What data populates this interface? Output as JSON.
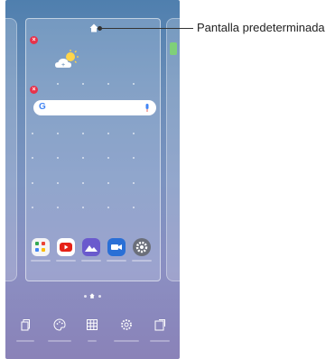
{
  "callout": {
    "label": "Pantalla predeterminada"
  },
  "colors": {
    "remove_badge": "#e8324a",
    "youtube": "#e62117",
    "gallery": "#6a5acd",
    "camera": "#2a6fd6",
    "settings": "#6b6f7a"
  },
  "home_screen": {
    "search_widget": {
      "logo": "G"
    },
    "apps": [
      {
        "name": "folder-app-icon"
      },
      {
        "name": "youtube-app-icon"
      },
      {
        "name": "gallery-app-icon"
      },
      {
        "name": "video-app-icon"
      },
      {
        "name": "settings-app-icon"
      }
    ]
  },
  "toolbar": {
    "tools": [
      {
        "name": "widgets-tool-icon"
      },
      {
        "name": "themes-tool-icon"
      },
      {
        "name": "grid-tool-icon"
      },
      {
        "name": "home-settings-tool-icon"
      },
      {
        "name": "screen-rotation-tool-icon"
      }
    ]
  }
}
